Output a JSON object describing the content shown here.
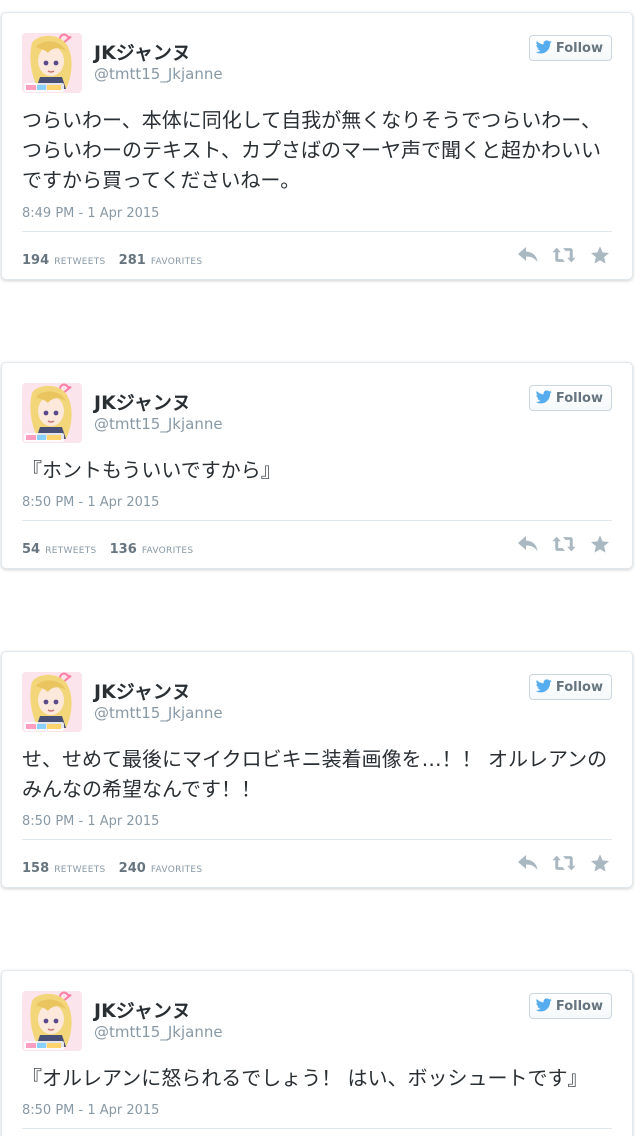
{
  "author": {
    "display_name": "JKジャンヌ",
    "handle": "@tmtt15_Jkjanne",
    "follow_label": "Follow"
  },
  "labels": {
    "retweets": "RETWEETS",
    "favorites": "FAVORITES"
  },
  "colors": {
    "twitter_blue": "#55acee",
    "icon_gray": "#aab8c2",
    "text": "#292f33",
    "muted": "#8899a6"
  },
  "icons": [
    "twitter-bird-icon",
    "reply-icon",
    "retweet-icon",
    "favorite-icon"
  ],
  "tweets": [
    {
      "text": "つらいわー、本体に同化して自我が無くなりそうでつらいわー、つらいわーのテキスト、カプさばのマーヤ声で聞くと超かわいいですから買ってくださいねー。",
      "timestamp": "8:49 PM - 1 Apr 2015",
      "retweets": "194",
      "favorites": "281"
    },
    {
      "text": "『ホントもういいですから』",
      "timestamp": "8:50 PM - 1 Apr 2015",
      "retweets": "54",
      "favorites": "136"
    },
    {
      "text": "せ、せめて最後にマイクロビキニ装着画像を…！！ オルレアンのみんなの希望なんです！！",
      "timestamp": "8:50 PM - 1 Apr 2015",
      "retweets": "158",
      "favorites": "240"
    },
    {
      "text": "『オルレアンに怒られるでしょう！ はい、ボッシュートです』",
      "timestamp": "8:50 PM - 1 Apr 2015"
    }
  ]
}
